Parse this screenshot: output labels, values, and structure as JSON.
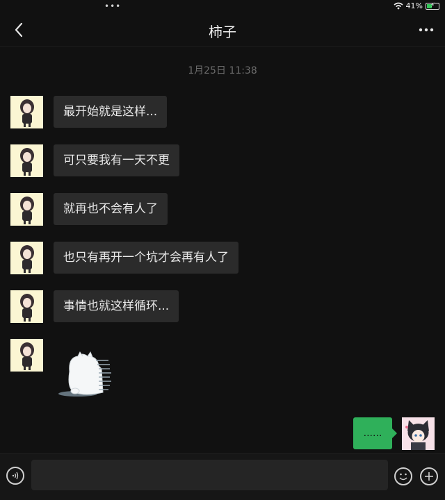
{
  "status": {
    "battery_text": "41%",
    "battery_level": 0.41,
    "icons": [
      "more-dots-icon",
      "wifi-icon",
      "battery-charging-icon"
    ]
  },
  "nav": {
    "title": "柿子",
    "back_icon": "chevron-left-icon",
    "more_icon": "more-horizontal-icon"
  },
  "chat": {
    "timestamp": "1月25日 11:38",
    "messages": [
      {
        "sender": "other",
        "text": "最开始就是这样..."
      },
      {
        "sender": "other",
        "text": "可只要我有一天不更"
      },
      {
        "sender": "other",
        "text": "就再也不会有人了"
      },
      {
        "sender": "other",
        "text": "也只有再开一个坑才会再有人了"
      },
      {
        "sender": "other",
        "text": "事情也就这样循环..."
      },
      {
        "sender": "other",
        "type": "sticker",
        "sticker": "cat-sticker"
      },
      {
        "sender": "self",
        "text": "......"
      }
    ]
  },
  "input_bar": {
    "voice_icon": "voice-icon",
    "emoji_icon": "emoji-icon",
    "plus_icon": "plus-icon",
    "placeholder": ""
  },
  "colors": {
    "background": "#111111",
    "incoming_bubble": "#2b2b2b",
    "outgoing_bubble": "#2fb05a",
    "timestamp": "#6c6c6c"
  }
}
